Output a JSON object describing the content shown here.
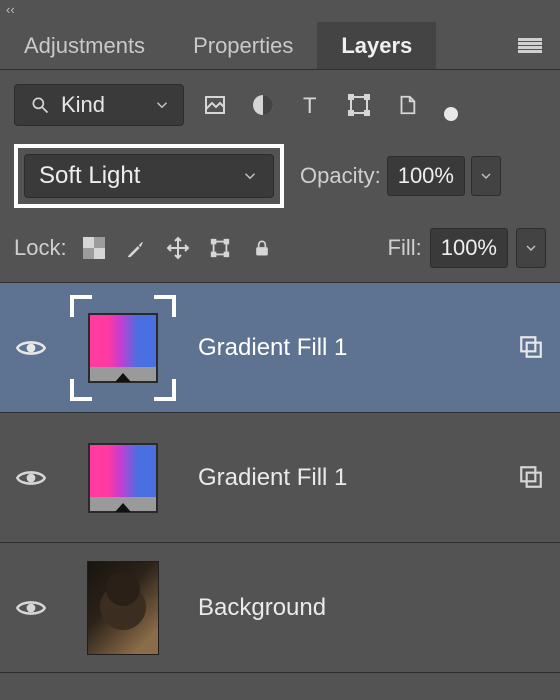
{
  "collapse_glyph": "‹‹",
  "tabs": {
    "adjustments": "Adjustments",
    "properties": "Properties",
    "layers": "Layers",
    "active": "layers"
  },
  "filter": {
    "kind_label": "Kind"
  },
  "blend": {
    "mode": "Soft Light",
    "opacity_label": "Opacity:",
    "opacity_value": "100%"
  },
  "lock": {
    "label": "Lock:",
    "fill_label": "Fill:",
    "fill_value": "100%"
  },
  "layers": [
    {
      "name": "Gradient Fill 1",
      "type": "fill",
      "selected": true,
      "visible": true,
      "showStyleIcon": true
    },
    {
      "name": "Gradient Fill 1",
      "type": "fill",
      "selected": false,
      "visible": true,
      "showStyleIcon": true
    },
    {
      "name": "Background",
      "type": "image",
      "selected": false,
      "visible": true,
      "showStyleIcon": false
    }
  ]
}
